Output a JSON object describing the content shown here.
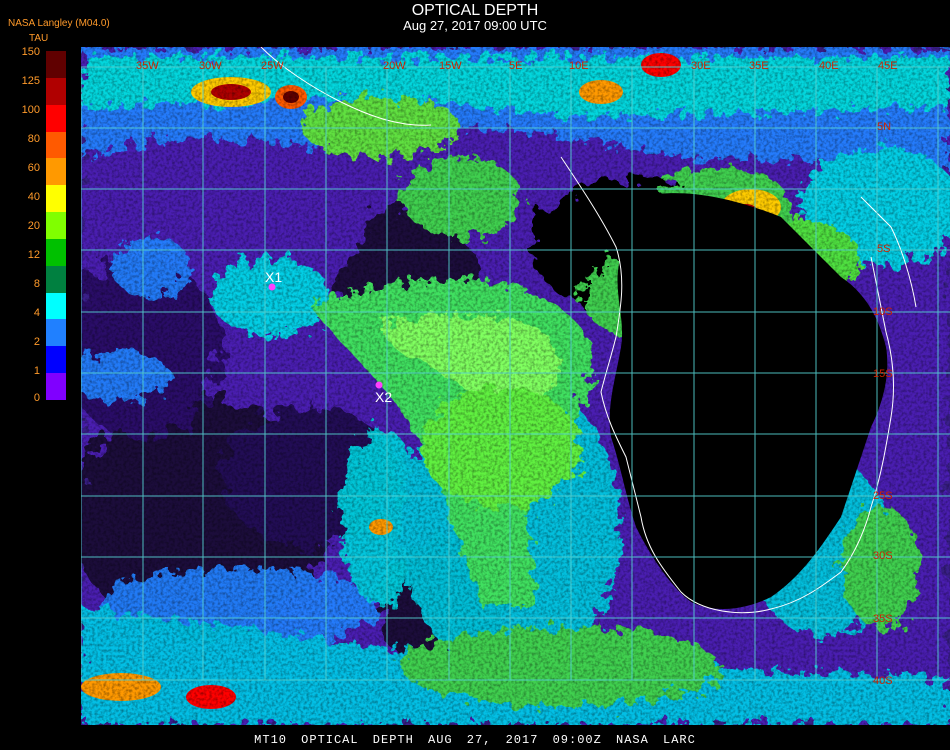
{
  "header": {
    "title": "OPTICAL DEPTH",
    "subtitle": "Aug 27, 2017 09:00 UTC",
    "provider": "NASA Langley (M04.0)"
  },
  "legend": {
    "unit": "TAU",
    "ticks": [
      "150",
      "125",
      "100",
      "80",
      "60",
      "40",
      "20",
      "12",
      "8",
      "4",
      "2",
      "1",
      "0"
    ],
    "colors": [
      "#600000",
      "#b00000",
      "#ff0000",
      "#ff5a00",
      "#ff9900",
      "#ffff00",
      "#80ff00",
      "#00c000",
      "#008040",
      "#00ffff",
      "#2080ff",
      "#0000ff",
      "#8000ff"
    ]
  },
  "map": {
    "lon_labels": [
      "35W",
      "30W",
      "25W",
      "20W",
      "15W",
      "5E",
      "10E",
      "30E",
      "35E",
      "40E",
      "45E"
    ],
    "lat_labels": [
      "5N",
      "5S",
      "10S",
      "15S",
      "25S",
      "30S",
      "35S",
      "40S"
    ],
    "markers": [
      {
        "label": "X1",
        "color": "#ff40ff"
      },
      {
        "label": "X2",
        "color": "#ff40ff"
      }
    ],
    "grid_color": "#55d0d0",
    "coast_color": "#ffffff",
    "label_color": "#cc2200"
  },
  "footer": {
    "text": "MT10 OPTICAL DEPTH AUG 27, 2017 09:00Z NASA LARC"
  }
}
